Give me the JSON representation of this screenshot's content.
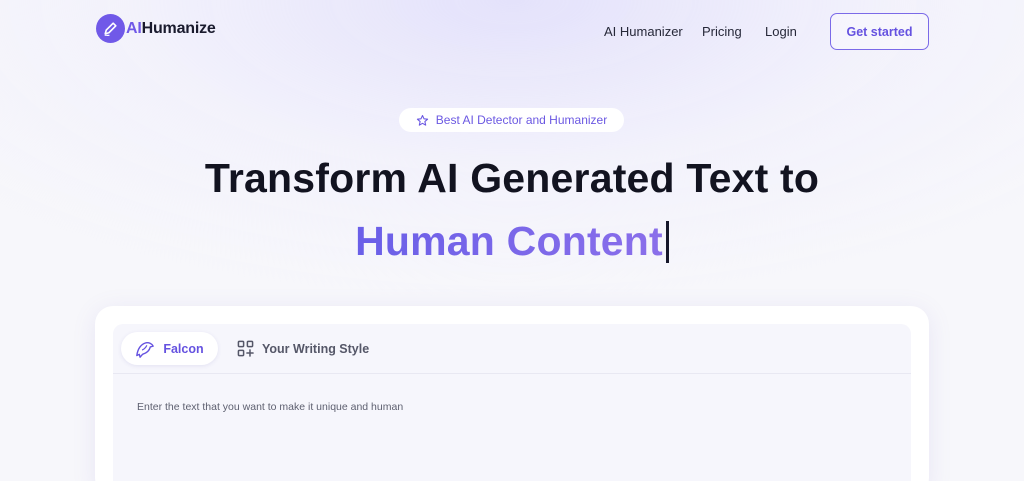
{
  "brand": {
    "prefix": "AI",
    "suffix": "Humanize",
    "accent_color": "#7059e8"
  },
  "nav": {
    "links": [
      "AI Humanizer",
      "Pricing",
      "Login"
    ],
    "cta_label": "Get started"
  },
  "hero": {
    "badge": "Best AI Detector and Humanizer",
    "headline_line1": "Transform AI Generated Text to",
    "headline_line2": "Human Content"
  },
  "editor": {
    "tabs": [
      {
        "label": "Falcon",
        "icon": "falcon-icon",
        "active": true
      },
      {
        "label": "Your Writing Style",
        "icon": "grid-plus-icon",
        "active": false
      }
    ],
    "placeholder": "Enter the text that you want to make it unique and human"
  }
}
